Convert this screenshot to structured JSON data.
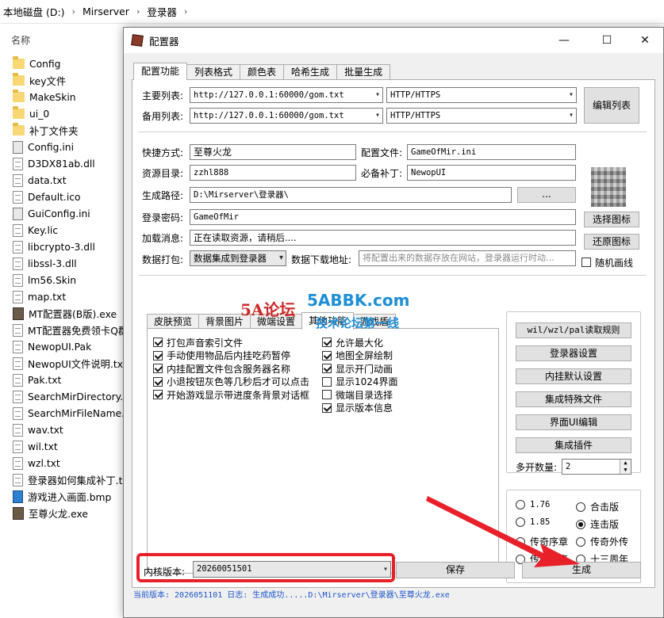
{
  "explorer": {
    "breadcrumb": [
      "本地磁盘 (D:)",
      "Mirserver",
      "登录器"
    ],
    "column_header": "名称",
    "files": [
      {
        "name": "Config",
        "icon": "folder-icon"
      },
      {
        "name": "key文件",
        "icon": "folder-icon"
      },
      {
        "name": "MakeSkin",
        "icon": "folder-icon"
      },
      {
        "name": "ui_0",
        "icon": "folder-icon"
      },
      {
        "name": "补丁文件夹",
        "icon": "folder-icon"
      },
      {
        "name": "Config.ini",
        "icon": "settings-file-icon"
      },
      {
        "name": "D3DX81ab.dll",
        "icon": "file-icon"
      },
      {
        "name": "data.txt",
        "icon": "file-icon"
      },
      {
        "name": "Default.ico",
        "icon": "file-icon"
      },
      {
        "name": "GuiConfig.ini",
        "icon": "settings-file-icon"
      },
      {
        "name": "Key.lic",
        "icon": "file-icon"
      },
      {
        "name": "libcrypto-3.dll",
        "icon": "file-icon"
      },
      {
        "name": "libssl-3.dll",
        "icon": "file-icon"
      },
      {
        "name": "lm56.Skin",
        "icon": "file-icon"
      },
      {
        "name": "map.txt",
        "icon": "file-icon"
      },
      {
        "name": "MT配置器(B版).exe",
        "icon": "exe-icon"
      },
      {
        "name": "MT配置器免费领卡Q群",
        "icon": "file-icon"
      },
      {
        "name": "NewopUI.Pak",
        "icon": "file-icon"
      },
      {
        "name": "NewopUI文件说明.txt",
        "icon": "file-icon"
      },
      {
        "name": "Pak.txt",
        "icon": "file-icon"
      },
      {
        "name": "SearchMirDirectory.t",
        "icon": "file-icon"
      },
      {
        "name": "SearchMirFileName.t",
        "icon": "file-icon"
      },
      {
        "name": "wav.txt",
        "icon": "file-icon"
      },
      {
        "name": "wil.txt",
        "icon": "file-icon"
      },
      {
        "name": "wzl.txt",
        "icon": "file-icon"
      },
      {
        "name": "登录器如何集成补丁.tx",
        "icon": "file-icon"
      },
      {
        "name": "游戏进入画面.bmp",
        "icon": "image-icon"
      },
      {
        "name": "至尊火龙.exe",
        "icon": "exe-icon"
      }
    ]
  },
  "window": {
    "title": "配置器",
    "controls": {
      "minimize": "—",
      "maximize": "☐",
      "close": "✕"
    }
  },
  "main_tabs": [
    "配置功能",
    "列表格式",
    "颜色表",
    "哈希生成",
    "批量生成"
  ],
  "lists": {
    "primary_label": "主要列表:",
    "primary_url": "http://127.0.0.1:60000/gom.txt",
    "primary_proto": "HTTP/HTTPS",
    "backup_label": "备用列表:",
    "backup_url": "http://127.0.0.1:60000/gom.txt",
    "backup_proto": "HTTP/HTTPS",
    "edit_button": "编辑列表"
  },
  "fields": {
    "shortcut_label": "快捷方式:",
    "shortcut_value": "至尊火龙",
    "config_label": "配置文件:",
    "config_value": "GameOfMir.ini",
    "resource_label": "资源目录:",
    "resource_value": "zzhl888",
    "patch_label": "必备补丁:",
    "patch_value": "NewopUI",
    "path_label": "生成路径:",
    "path_value": "D:\\Mirserver\\登录器\\",
    "browse_button": "...",
    "password_label": "登录密码:",
    "password_value": "GameOfMir",
    "loading_label": "加载消息:",
    "loading_value": "正在读取资源，请稍后....",
    "pack_label": "数据打包:",
    "pack_value": "数据集成到登录器",
    "download_label": "数据下载地址:",
    "download_placeholder": "将配置出来的数据存放在网站，登录器运行时动…"
  },
  "icon_panel": {
    "select_button": "选择图标",
    "restore_button": "还原图标",
    "random_frame": "随机画线"
  },
  "sub_tabs": [
    "皮肤预览",
    "背景图片",
    "微端设置",
    "其他功能",
    "游戏盾"
  ],
  "options_left": [
    {
      "label": "打包声音索引文件",
      "checked": true
    },
    {
      "label": "手动使用物品后内挂吃药暂停",
      "checked": true
    },
    {
      "label": "内挂配置文件包含服务器名称",
      "checked": true
    },
    {
      "label": "小退按钮灰色等几秒后才可以点击",
      "checked": true
    },
    {
      "label": "开始游戏显示带进度条背景对话框",
      "checked": true
    }
  ],
  "options_right": [
    {
      "label": "允许最大化",
      "checked": true
    },
    {
      "label": "地图全屏绘制",
      "checked": true
    },
    {
      "label": "显示开门动画",
      "checked": true
    },
    {
      "label": "显示1024界面",
      "checked": false
    },
    {
      "label": "微端目录选择",
      "checked": false
    },
    {
      "label": "显示版本信息",
      "checked": true
    }
  ],
  "side_buttons": [
    "wil/wzl/pal读取规则",
    "登录器设置",
    "内挂默认设置",
    "集成特殊文件",
    "界面UI编辑",
    "集成插件"
  ],
  "multi_open": {
    "label": "多开数量:",
    "value": "2"
  },
  "versions": [
    {
      "label": "1.76",
      "checked": false
    },
    {
      "label": "合击版",
      "checked": false
    },
    {
      "label": "1.85",
      "checked": false
    },
    {
      "label": "连击版",
      "checked": true
    },
    {
      "label": "传奇序章",
      "checked": false
    },
    {
      "label": "传奇外传",
      "checked": false
    },
    {
      "label": "传奇归来",
      "checked": false
    },
    {
      "label": "十三周年",
      "checked": false
    }
  ],
  "bottom": {
    "kernel_label": "内核版本:",
    "kernel_value": "20260051501",
    "save_button": "保存",
    "generate_button": "生成",
    "status": "当前版本: 2026051101 日志: 生成成功.....D:\\Mirserver\\登录器\\至尊火龙.exe"
  },
  "watermark": {
    "logo": "5A论坛",
    "site": "5ABBK.com",
    "slogan": "技术论坛第一线"
  },
  "colors": {
    "highlight": "#e8202a",
    "status_text": "#1a55c9"
  }
}
